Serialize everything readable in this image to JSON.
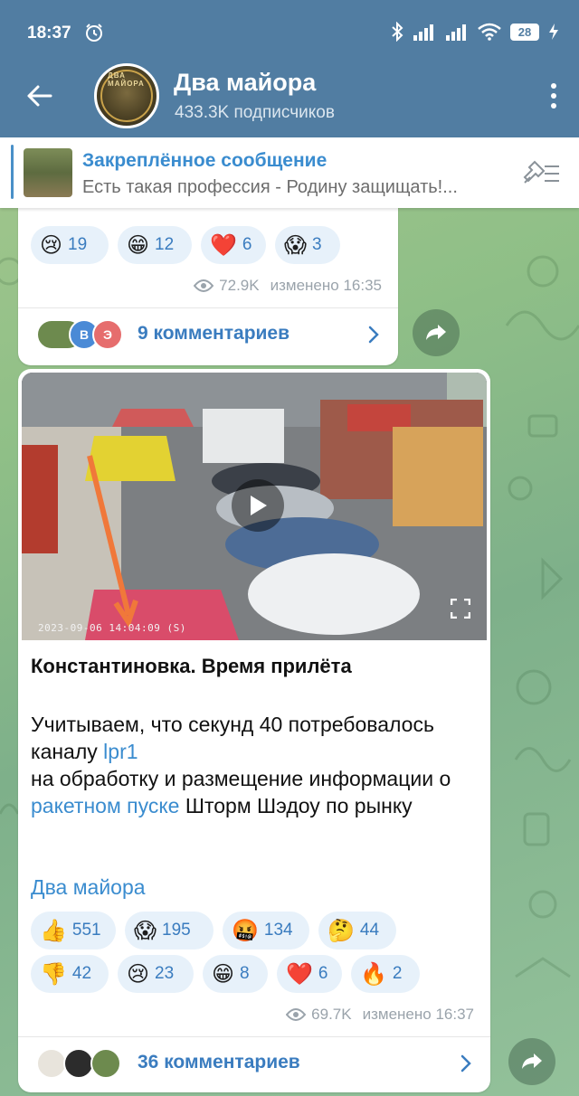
{
  "status_bar": {
    "time": "18:37",
    "battery": "28"
  },
  "header": {
    "title": "Два майора",
    "subtitle": "433.3K подписчиков",
    "avatar_text": "ДВА МАЙОРА"
  },
  "pinned": {
    "title": "Закреплённое сообщение",
    "text": "Есть такая профессия - Родину защищать!..."
  },
  "message1": {
    "reactions": [
      {
        "emoji": "😢",
        "count": "19"
      },
      {
        "emoji": "😁",
        "count": "12"
      },
      {
        "emoji": "❤️",
        "count": "6"
      },
      {
        "emoji": "😱",
        "count": "3"
      }
    ],
    "views": "72.9K",
    "edited": "изменено 16:35",
    "comment_avatars": [
      "В",
      "Э"
    ],
    "comments": "9 комментариев"
  },
  "message2": {
    "video_timestamp": "2023-09-06 14:04:09 (S)",
    "title": "Константиновка. Время прилёта",
    "body": {
      "part1": "Учитываем, что секунд 40 потребовалось каналу ",
      "link1": "lpr1",
      "part2": " на обработку и размещение информации о ",
      "link2": "ракетном пуске",
      "part3": " Шторм Шэдоу по рынку"
    },
    "signature": "Два майора",
    "reactions": [
      {
        "emoji": "👍",
        "count": "551"
      },
      {
        "emoji": "😱",
        "count": "195"
      },
      {
        "emoji": "🤬",
        "count": "134"
      },
      {
        "emoji": "🤔",
        "count": "44"
      },
      {
        "emoji": "👎",
        "count": "42"
      },
      {
        "emoji": "😢",
        "count": "23"
      },
      {
        "emoji": "😁",
        "count": "8"
      },
      {
        "emoji": "❤️",
        "count": "6"
      },
      {
        "emoji": "🔥",
        "count": "2"
      }
    ],
    "views": "69.7K",
    "edited": "изменено 16:37",
    "comments": "36 комментариев"
  },
  "colors": {
    "header": "#517da2",
    "accent": "#3a8ccf",
    "reaction_bg": "#e7f1fa"
  }
}
